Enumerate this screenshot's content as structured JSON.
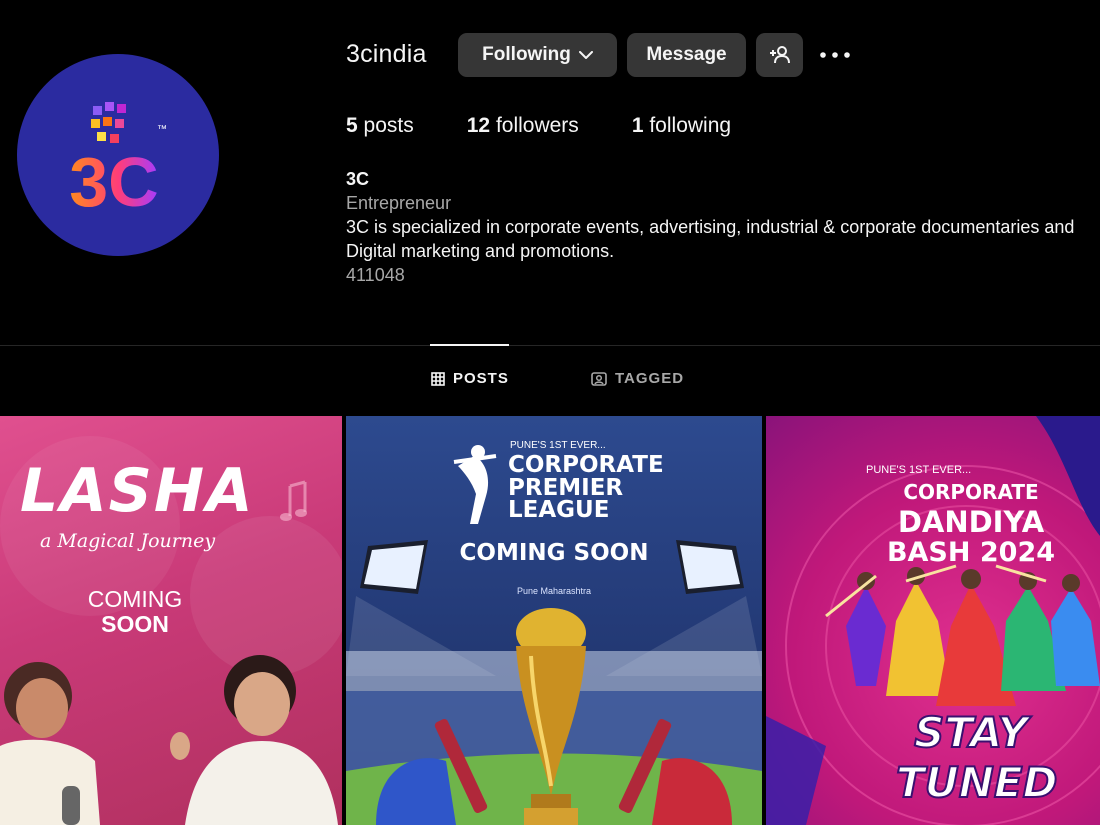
{
  "profile": {
    "username": "3cindia",
    "avatar_text": "3C",
    "avatar_tm": "™"
  },
  "actions": {
    "following_label": "Following",
    "message_label": "Message"
  },
  "stats": {
    "posts_count": "5",
    "posts_label": "posts",
    "followers_count": "12",
    "followers_label": "followers",
    "following_count": "1",
    "following_label": "following"
  },
  "bio": {
    "name": "3C",
    "category": "Entrepreneur",
    "line1": "3C is specialized in corporate events, advertising, industrial & corporate documentaries and",
    "line2": "Digital marketing and promotions.",
    "line3": "411048"
  },
  "tabs": [
    {
      "label": "POSTS",
      "active": true
    },
    {
      "label": "TAGGED",
      "active": false
    }
  ],
  "posts": [
    {
      "title": "LASHA",
      "subtitle": "a Magical Journey",
      "line1": "COMING",
      "line2": "SOON"
    },
    {
      "kicker": "PUNE'S 1ST EVER...",
      "title1": "CORPORATE",
      "title2": "PREMIER",
      "title3": "LEAGUE",
      "banner": "COMING SOON",
      "location": "Pune Maharashtra"
    },
    {
      "kicker": "PUNE'S 1ST EVER...",
      "title1": "CORPORATE",
      "title2": "DANDIYA",
      "title3": "BASH 2024",
      "tag1": "STAY",
      "tag2": "TUNED"
    }
  ],
  "colors": {
    "background": "#000000",
    "button": "#363636",
    "muted": "#a8a8a8",
    "avatar_bg": "#2b2ba0"
  },
  "icons": [
    "chevron-down-icon",
    "add-user-icon",
    "more-icon",
    "grid-icon",
    "tagged-icon"
  ]
}
